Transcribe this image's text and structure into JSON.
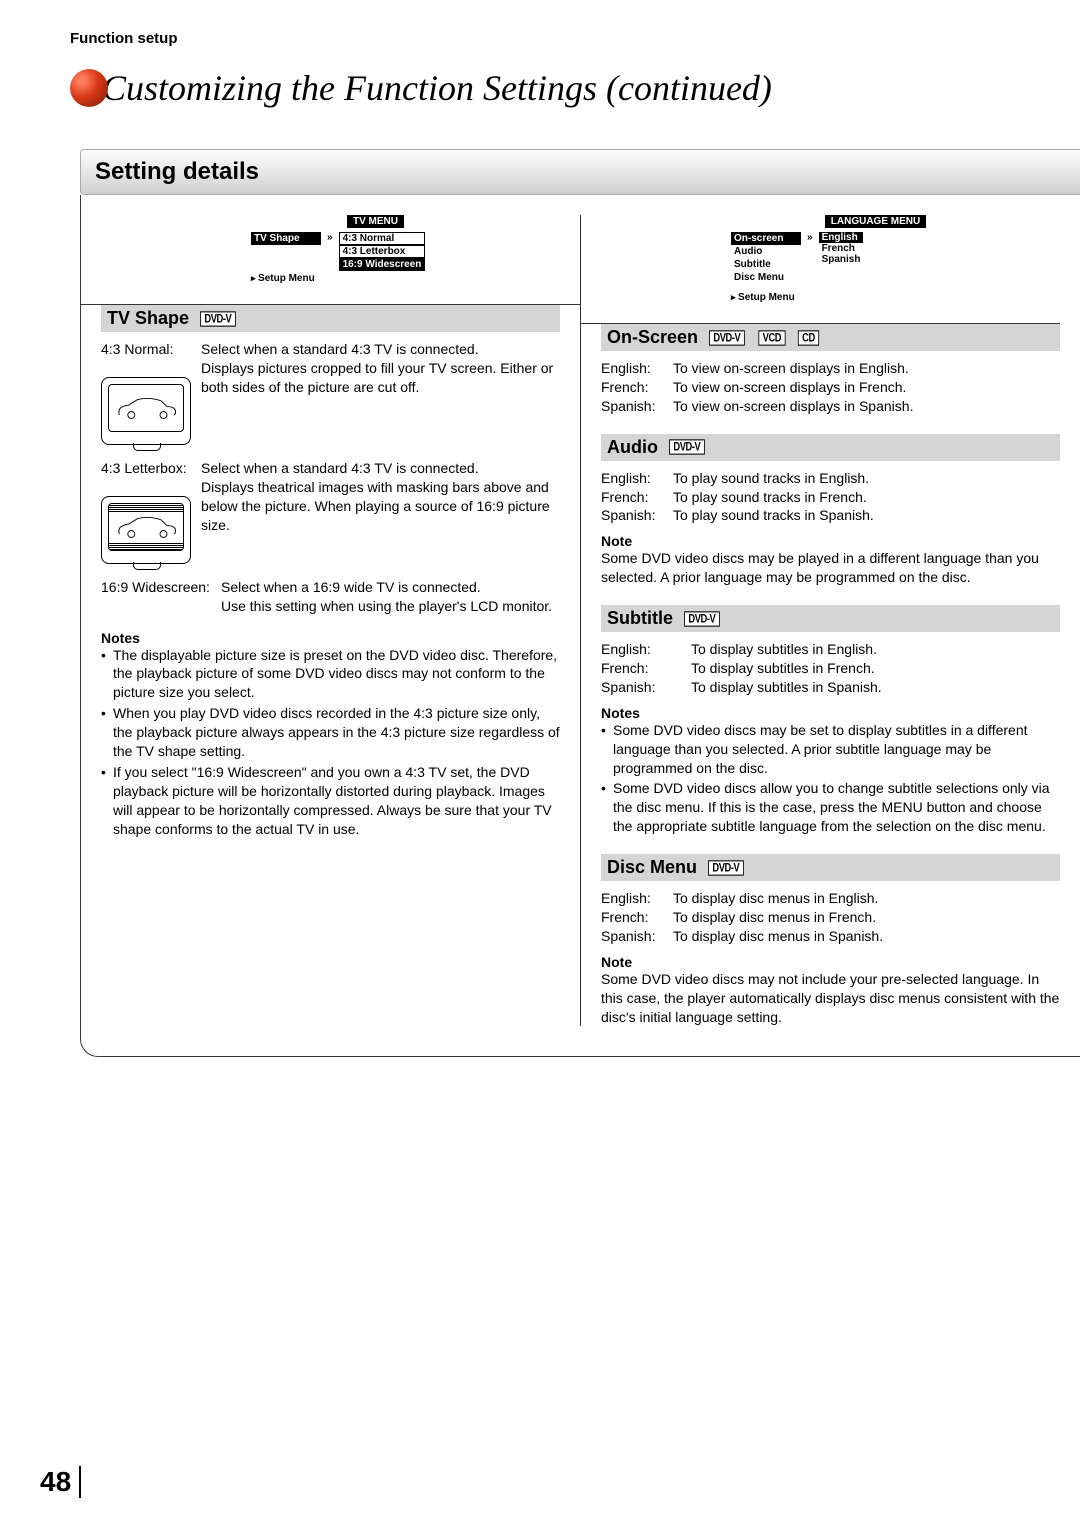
{
  "header_label": "Function setup",
  "page_title": "Customizing the Function Settings (continued)",
  "section_heading": "Setting details",
  "page_number": "48",
  "left": {
    "menu": {
      "title": "TV MENU",
      "item_selected": "TV Shape",
      "setup": "Setup Menu",
      "options": [
        "4:3  Normal",
        "4:3  Letterbox",
        "16:9  Widescreen"
      ]
    },
    "heading": "TV Shape",
    "badges": [
      "DVD-V"
    ],
    "opts": [
      {
        "label": "4:3 Normal:",
        "desc": "Select when a standard 4:3 TV is connected.\nDisplays pictures cropped to fill your TV screen.  Either or both sides of the picture are cut off."
      },
      {
        "label": "4:3 Letterbox:",
        "desc": "Select when a standard 4:3 TV is connected.\nDisplays theatrical images with masking bars above and below the picture. When playing a source of 16:9 picture size."
      },
      {
        "label": "16:9 Widescreen:",
        "desc": "Select when a 16:9 wide TV is connected.\nUse this setting when using the player's LCD monitor."
      }
    ],
    "notes_heading": "Notes",
    "notes": [
      "The displayable picture size is preset on the DVD video disc. Therefore, the playback picture of some DVD video discs may not conform to the picture size you select.",
      "When you play DVD video discs recorded in the 4:3 picture size only, the playback picture always appears in the 4:3 picture size regardless of the TV shape setting.",
      "If you select \"16:9 Widescreen\" and you own a 4:3 TV set, the DVD playback picture will be horizontally distorted during playback. Images will appear to be horizontally compressed.  Always be sure that your TV shape conforms to the actual TV in use."
    ]
  },
  "right": {
    "menu": {
      "title": "LANGUAGE MENU",
      "items": [
        "On-screen",
        "Audio",
        "Subtitle",
        "Disc Menu"
      ],
      "setup": "Setup Menu",
      "options": [
        "English",
        "French",
        "Spanish"
      ]
    },
    "sections": {
      "onscreen": {
        "heading": "On-Screen",
        "badges": [
          "DVD-V",
          "VCD",
          "CD"
        ],
        "rows": [
          {
            "label": "English:",
            "desc": "To view on-screen displays in English."
          },
          {
            "label": "French:",
            "desc": "To view on-screen displays in French."
          },
          {
            "label": "Spanish:",
            "desc": "To view on-screen displays in Spanish."
          }
        ]
      },
      "audio": {
        "heading": "Audio",
        "badges": [
          "DVD-V"
        ],
        "rows": [
          {
            "label": "English:",
            "desc": "To play sound tracks in English."
          },
          {
            "label": "French:",
            "desc": "To play sound tracks in French."
          },
          {
            "label": "Spanish:",
            "desc": "To play sound tracks in Spanish."
          }
        ],
        "note_heading": "Note",
        "note": "Some DVD video discs may be played in a different language than you selected. A prior language may be programmed on the disc."
      },
      "subtitle": {
        "heading": "Subtitle",
        "badges": [
          "DVD-V"
        ],
        "rows": [
          {
            "label": "English:",
            "desc": "To display subtitles in English."
          },
          {
            "label": "French:",
            "desc": "To display subtitles in French."
          },
          {
            "label": "Spanish:",
            "desc": "To display subtitles in Spanish."
          }
        ],
        "notes_heading": "Notes",
        "notes": [
          "Some DVD video discs may be set to display subtitles in a different language than you selected. A prior subtitle language may be programmed on the disc.",
          "Some DVD video discs allow you to change subtitle selections only via the disc menu.  If this is the case, press the MENU button and choose the appropriate subtitle language from the selection on the disc menu."
        ]
      },
      "discmenu": {
        "heading": "Disc Menu",
        "badges": [
          "DVD-V"
        ],
        "rows": [
          {
            "label": "English:",
            "desc": "To display disc menus in English."
          },
          {
            "label": "French:",
            "desc": "To display disc menus in French."
          },
          {
            "label": "Spanish:",
            "desc": "To display disc menus in Spanish."
          }
        ],
        "note_heading": "Note",
        "note": "Some DVD video discs may not include your pre-selected language. In this case, the player automatically displays disc menus consistent with the disc's initial language setting."
      }
    }
  }
}
